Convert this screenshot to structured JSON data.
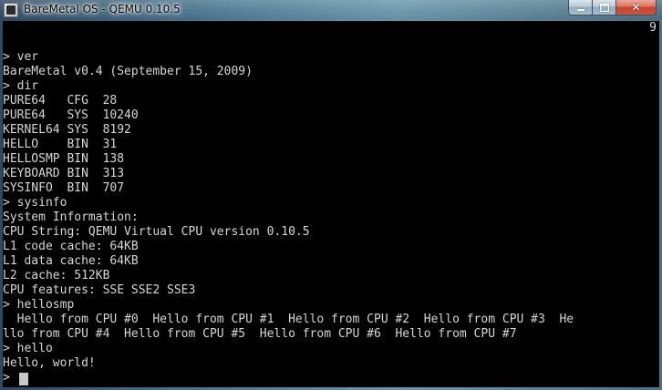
{
  "window": {
    "title": "BareMetal OS - QEMU 0.10.5",
    "controls": {
      "minimize": "",
      "maximize": "",
      "close": "✕"
    }
  },
  "console": {
    "corner_number": "9",
    "lines": [
      "",
      "",
      "> ver",
      "BareMetal v0.4 (September 15, 2009)",
      "> dir",
      "PURE64   CFG  28",
      "PURE64   SYS  10240",
      "KERNEL64 SYS  8192",
      "HELLO    BIN  31",
      "HELLOSMP BIN  138",
      "KEYBOARD BIN  313",
      "SYSINFO  BIN  707",
      "> sysinfo",
      "System Information:",
      "CPU String: QEMU Virtual CPU version 0.10.5",
      "L1 code cache: 64KB",
      "L1 data cache: 64KB",
      "L2 cache: 512KB",
      "CPU features: SSE SSE2 SSE3",
      "> hellosmp",
      "  Hello from CPU #0  Hello from CPU #1  Hello from CPU #2  Hello from CPU #3  He",
      "llo from CPU #4  Hello from CPU #5  Hello from CPU #6  Hello from CPU #7",
      "> hello",
      "Hello, world!",
      "> "
    ]
  }
}
